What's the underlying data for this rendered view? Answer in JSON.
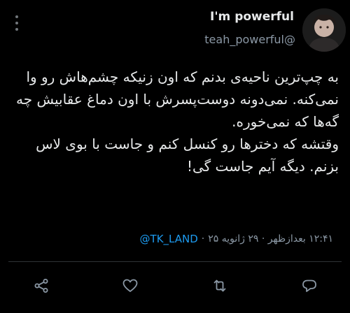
{
  "author": {
    "display_name": "I'm powerful",
    "handle": "teah_powerful@"
  },
  "tweet": {
    "paragraphs": [
      "به چپ‌ترین ناحیه‌ی بدنم که اون زنیکه چشم‌هاش رو وا نمی‌کنه. نمی‌دونه دوست‌پسرش با اون دماغ عقابیش چه گه‌ها که نمی‌خوره.",
      "وقتشه که دخترها رو کنسل کنم و جاست با بوی لاس بزنم. دیگه آیم جاست گی!"
    ]
  },
  "meta": {
    "timestamp": "۱۲:۴۱ بعدازظهر · ۲۹ ژانویه ۲۵",
    "separator": "·",
    "via": "TK_LAND@"
  },
  "actions": [
    {
      "name": "reply",
      "icon": "reply-icon"
    },
    {
      "name": "retweet",
      "icon": "retweet-icon"
    },
    {
      "name": "like",
      "icon": "heart-icon"
    },
    {
      "name": "share",
      "icon": "share-icon"
    }
  ],
  "colors": {
    "background": "#000000",
    "text": "#e7e9ea",
    "secondary": "#8b98a5",
    "link": "#1d9bf0"
  }
}
